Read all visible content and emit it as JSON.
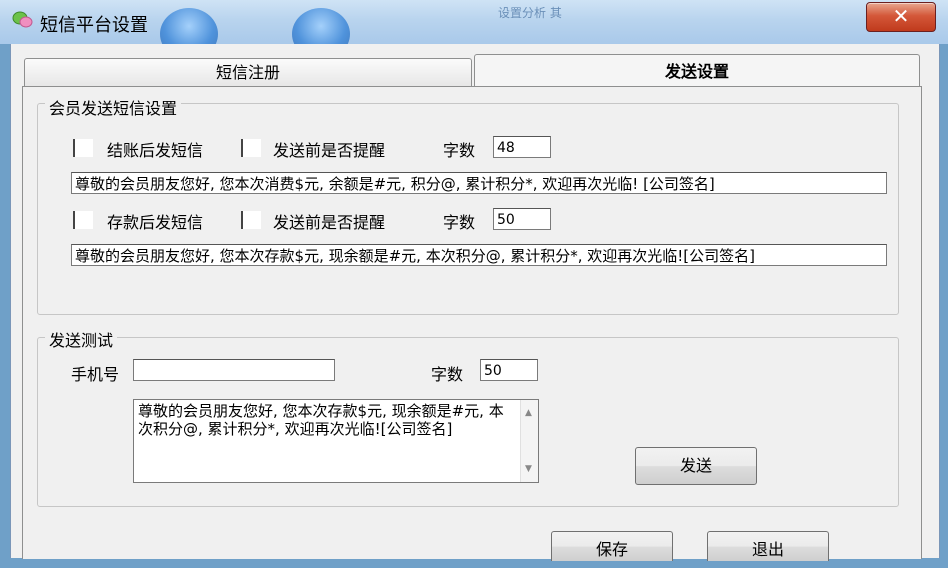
{
  "window": {
    "title": "短信平台设置",
    "close_symbol": "✕",
    "bg_hint": "设置分析 其"
  },
  "tabs": [
    {
      "label": "短信注册",
      "selected": false
    },
    {
      "label": "发送设置",
      "selected": true
    }
  ],
  "member_group": {
    "title": "会员发送短信设置",
    "row1": {
      "checkbox1_label": "结账后发短信",
      "checkbox2_label": "发送前是否提醒",
      "count_label": "字数",
      "count_value": "48",
      "message": "尊敬的会员朋友您好, 您本次消费$元, 余额是#元, 积分@, 累计积分*, 欢迎再次光临! [公司签名]"
    },
    "row2": {
      "checkbox1_label": "存款后发短信",
      "checkbox2_label": "发送前是否提醒",
      "count_label": "字数",
      "count_value": "50",
      "message": "尊敬的会员朋友您好, 您本次存款$元, 现余额是#元, 本次积分@, 累计积分*, 欢迎再次光临![公司签名]"
    }
  },
  "test_group": {
    "title": "发送测试",
    "phone_label": "手机号",
    "phone_value": "",
    "count_label": "字数",
    "count_value": "50",
    "message": "尊敬的会员朋友您好, 您本次存款$元, 现余额是#元, 本次积分@, 累计积分*, 欢迎再次光临![公司签名]",
    "send_label": "发送"
  },
  "footer": {
    "save_label": "保存",
    "exit_label": "退出"
  }
}
